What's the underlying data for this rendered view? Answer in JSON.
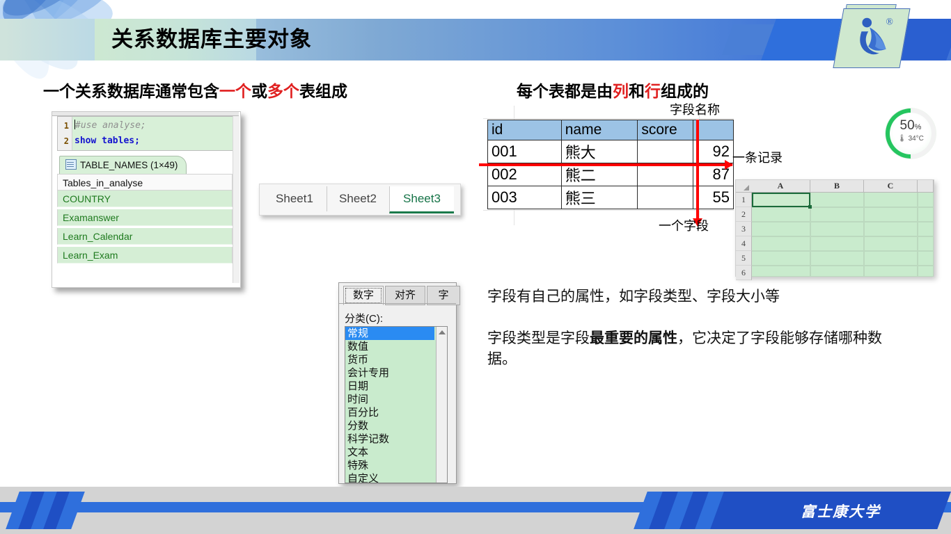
{
  "slide": {
    "title": "关系数据库主要对象",
    "footer_brand": "富士康大学"
  },
  "headings": {
    "left": {
      "part1": "一个关系数据库通常包含",
      "red1": "一个",
      "mid": "或",
      "red2": "多个",
      "part2": "表组成"
    },
    "right": {
      "part1": "每个表都是由",
      "red1": "列",
      "mid": "和",
      "red2": "行",
      "part2": "组成的"
    }
  },
  "sql_editor": {
    "line1_no": "1",
    "line1_code": "#use analyse;",
    "line2_no": "2",
    "line2_code": "show tables;",
    "result_tab": "TABLE_NAMES (1×49)",
    "result_header": "Tables_in_analyse",
    "result_rows": [
      "COUNTRY",
      "Examanswer",
      "Learn_Calendar",
      "Learn_Exam"
    ]
  },
  "sheet_tabs": {
    "items": [
      "Sheet1",
      "Sheet2",
      "Sheet3"
    ],
    "active": "Sheet3"
  },
  "data_table": {
    "columns": [
      "id",
      "name",
      "score",
      ""
    ],
    "rows": [
      {
        "id": "001",
        "name": "熊大",
        "score": "",
        "value": "92"
      },
      {
        "id": "002",
        "name": "熊二",
        "score": "",
        "value": "87"
      },
      {
        "id": "003",
        "name": "熊三",
        "score": "",
        "value": "55"
      }
    ],
    "annotations": {
      "field_name": "字段名称",
      "one_record": "一条记录",
      "one_field": "一个字段"
    },
    "header_color": "#9cc3e5",
    "annotation_color": "#ff0000"
  },
  "excel_grid": {
    "columns": [
      "A",
      "B",
      "C"
    ],
    "rows": [
      "1",
      "2",
      "3",
      "4",
      "5",
      "6"
    ],
    "selected_cell": "A1"
  },
  "format_dialog": {
    "tabs": [
      "数字",
      "对齐",
      "字"
    ],
    "active_tab": "数字",
    "label": "分类(C):",
    "list_items": [
      "常规",
      "数值",
      "货币",
      "会计专用",
      "日期",
      "时间",
      "百分比",
      "分数",
      "科学记数",
      "文本",
      "特殊",
      "自定义"
    ],
    "selected_item": "常规"
  },
  "paragraphs": {
    "p1": "字段有自己的属性，如字段类型、字段大小等",
    "p2_before": "字段类型是字段",
    "p2_bold": "最重要的属性",
    "p2_after": "，它决定了字段能够存储哪种数据。"
  },
  "battery_widget": {
    "percent": "50",
    "percent_unit": "%",
    "temperature": "34°C",
    "accent_color": "#25c55f"
  }
}
